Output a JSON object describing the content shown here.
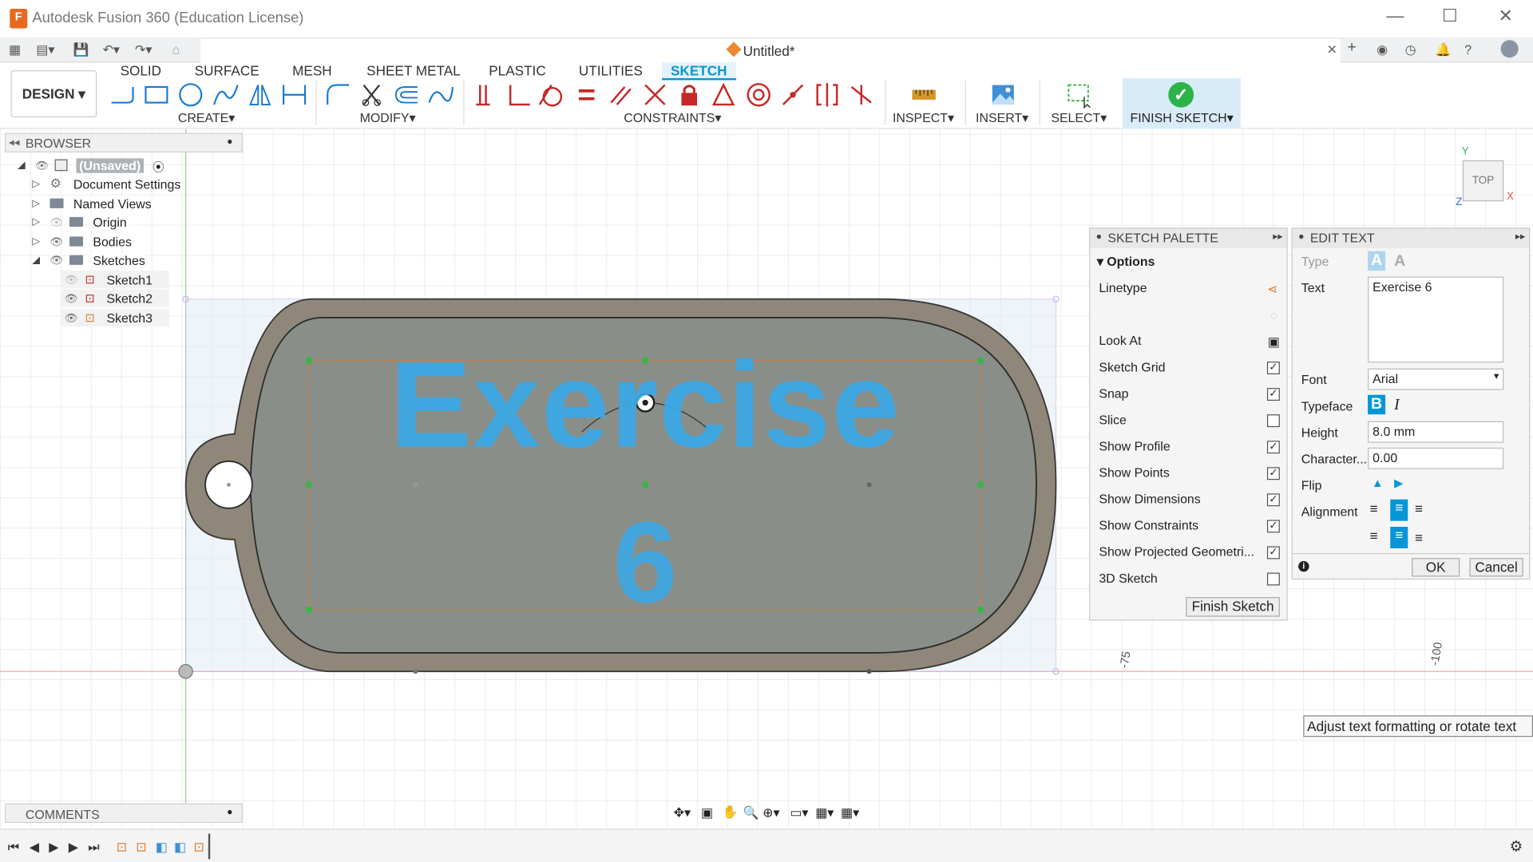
{
  "window": {
    "title": "Autodesk Fusion 360 (Education License)",
    "logo_text": "F",
    "document_title": "Untitled*"
  },
  "ribbon": {
    "workspace": "DESIGN",
    "tabs": [
      "SOLID",
      "SURFACE",
      "MESH",
      "SHEET METAL",
      "PLASTIC",
      "UTILITIES",
      "SKETCH"
    ],
    "active_tab": "SKETCH",
    "groups": {
      "create": "CREATE",
      "modify": "MODIFY",
      "constraints": "CONSTRAINTS",
      "inspect": "INSPECT",
      "insert": "INSERT",
      "select": "SELECT",
      "finish": "FINISH SKETCH"
    }
  },
  "browser": {
    "title": "BROWSER",
    "items": [
      {
        "label": "(Unsaved)"
      },
      {
        "label": "Document Settings"
      },
      {
        "label": "Named Views"
      },
      {
        "label": "Origin"
      },
      {
        "label": "Bodies"
      },
      {
        "label": "Sketches"
      },
      {
        "label": "Sketch1"
      },
      {
        "label": "Sketch2"
      },
      {
        "label": "Sketch3"
      }
    ]
  },
  "comments": {
    "title": "COMMENTS"
  },
  "viewcube": {
    "face": "TOP",
    "axis_y": "Y",
    "axis_x": "X",
    "axis_z": "Z"
  },
  "sketch": {
    "text_line1": "Exercise",
    "text_line2": "6",
    "dim_a": "-75",
    "dim_b": "-100"
  },
  "palette": {
    "title": "SKETCH PALETTE",
    "section": "Options",
    "rows": [
      {
        "label": "Linetype",
        "checked": null
      },
      {
        "label": "Look At",
        "checked": null
      },
      {
        "label": "Sketch Grid",
        "checked": true
      },
      {
        "label": "Snap",
        "checked": true
      },
      {
        "label": "Slice",
        "checked": false
      },
      {
        "label": "Show Profile",
        "checked": true
      },
      {
        "label": "Show Points",
        "checked": true
      },
      {
        "label": "Show Dimensions",
        "checked": true
      },
      {
        "label": "Show Constraints",
        "checked": true
      },
      {
        "label": "Show Projected Geometri...",
        "checked": true
      },
      {
        "label": "3D Sketch",
        "checked": false
      }
    ],
    "finish_button": "Finish Sketch",
    "check_mark": "✓"
  },
  "edit_text": {
    "title": "EDIT TEXT",
    "type_label": "Type",
    "text_label": "Text",
    "text_value": "Exercise 6",
    "font_label": "Font",
    "font_value": "Arial",
    "typeface_label": "Typeface",
    "height_label": "Height",
    "height_value": "8.0 mm",
    "character_label": "Character...",
    "character_value": "0.00",
    "flip_label": "Flip",
    "alignment_label": "Alignment",
    "ok": "OK",
    "cancel": "Cancel"
  },
  "tooltip": "Adjust text formatting or rotate text",
  "colors": {
    "accent": "#0696d7",
    "finish_bg": "#d8ecf8",
    "body_fill": "#8f887a",
    "text_blue": "#3aa9e8"
  }
}
